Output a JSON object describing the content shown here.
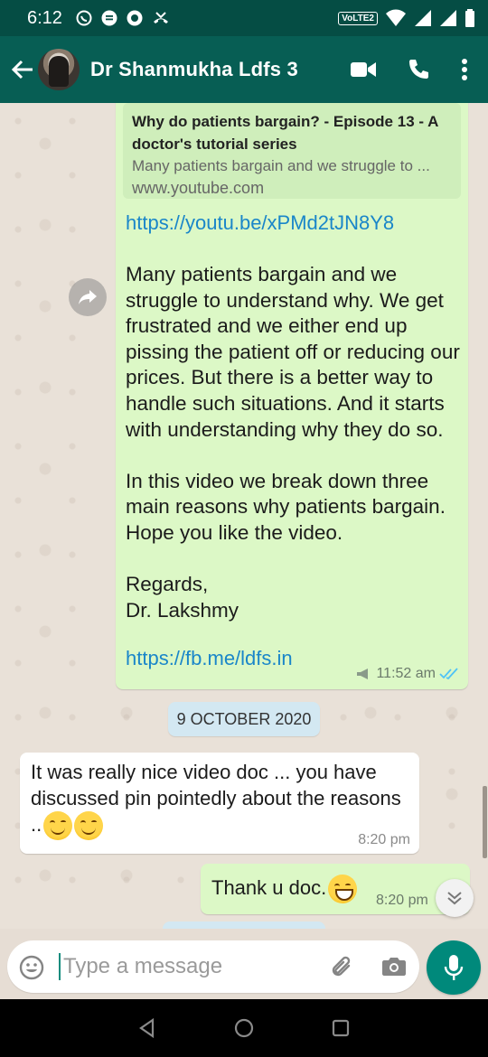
{
  "status_bar": {
    "time": "6:12",
    "network_label": "VoLTE2"
  },
  "header": {
    "contact_name": "Dr Shanmukha Ldfs 3"
  },
  "messages": {
    "outgoing_1": {
      "preview_title": "Why do patients bargain? - Episode 13 - A doctor's tutorial series",
      "preview_description": "Many patients bargain and we struggle to ...",
      "preview_domain": "www.youtube.com",
      "link": "https://youtu.be/xPMd2tJN8Y8",
      "body": "Many patients bargain and we struggle to understand why. We get frustrated and we either end up pissing the patient off or reducing our prices. But there is a better way to handle such situations. And it starts with understanding why they do so.\n\nIn this video we break down three main reasons why patients bargain. Hope you like the video.\n\nRegards,\nDr. Lakshmy",
      "signature_link": "https://fb.me/ldfs.in",
      "time": "11:52 am"
    },
    "date_separator": "9 OCTOBER 2020",
    "incoming_1": {
      "text": "It was really nice video doc ... you have discussed pin pointedly about the reasons ..",
      "time": "8:20 pm"
    },
    "outgoing_2": {
      "text": "Thank u doc.",
      "time": "8:20 pm"
    }
  },
  "input": {
    "placeholder": "Type a message"
  },
  "colors": {
    "header": "#075e54",
    "outgoing_bubble": "#dcf8c6",
    "link": "#1a86c9",
    "mic_button": "#00897b",
    "read_tick": "#4fc3f7"
  }
}
